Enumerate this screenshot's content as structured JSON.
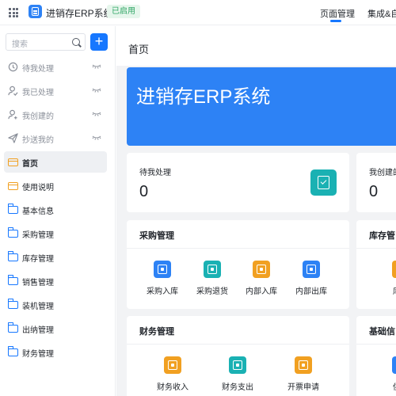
{
  "app": {
    "title": "进销存ERP系统",
    "status_badge": "已启用",
    "tabs": [
      "页面管理",
      "集成&自"
    ]
  },
  "colors": {
    "accent": "#1677ff",
    "banner": "#2d82f5",
    "teal": "#1ab1b3",
    "orange": "#f1a021",
    "blue_icon": "#2d82f5"
  },
  "sidebar": {
    "search_placeholder": "搜索",
    "add_label": "+",
    "workflow": [
      {
        "label": "待我处理",
        "icon": "clock-icon"
      },
      {
        "label": "我已处理",
        "icon": "user-check-icon"
      },
      {
        "label": "我创建的",
        "icon": "user-add-icon"
      },
      {
        "label": "抄送我的",
        "icon": "send-icon"
      }
    ],
    "pages": [
      {
        "label": "首页",
        "icon": "page-icon",
        "active": true
      },
      {
        "label": "使用说明",
        "icon": "page-icon"
      },
      {
        "label": "基本信息",
        "icon": "folder-icon"
      },
      {
        "label": "采购管理",
        "icon": "folder-icon"
      },
      {
        "label": "库存管理",
        "icon": "folder-icon"
      },
      {
        "label": "销售管理",
        "icon": "folder-icon"
      },
      {
        "label": "装机管理",
        "icon": "folder-icon"
      },
      {
        "label": "出纳管理",
        "icon": "folder-icon"
      },
      {
        "label": "财务管理",
        "icon": "folder-icon"
      }
    ]
  },
  "main": {
    "page_title": "首页",
    "banner_title": "进销存ERP系统",
    "stats": [
      {
        "label": "待我处理",
        "value": "0"
      },
      {
        "label": "我创建的",
        "value": "0"
      }
    ],
    "sections": [
      {
        "title": "采购管理",
        "items": [
          {
            "label": "采购入库",
            "color": "#2d82f5"
          },
          {
            "label": "采购退货",
            "color": "#1ab1b3"
          },
          {
            "label": "内部入库",
            "color": "#f1a021"
          },
          {
            "label": "内部出库",
            "color": "#2d82f5"
          }
        ]
      },
      {
        "title": "库存管",
        "items": [
          {
            "label": "库存",
            "color": "#f1a021"
          }
        ]
      },
      {
        "title": "财务管理",
        "items": [
          {
            "label": "财务收入",
            "color": "#f1a021"
          },
          {
            "label": "财务支出",
            "color": "#1ab1b3"
          },
          {
            "label": "开票申请",
            "color": "#f1a021"
          }
        ]
      },
      {
        "title": "基础信",
        "items": [
          {
            "label": "供应",
            "color": "#2d82f5"
          }
        ]
      }
    ]
  }
}
